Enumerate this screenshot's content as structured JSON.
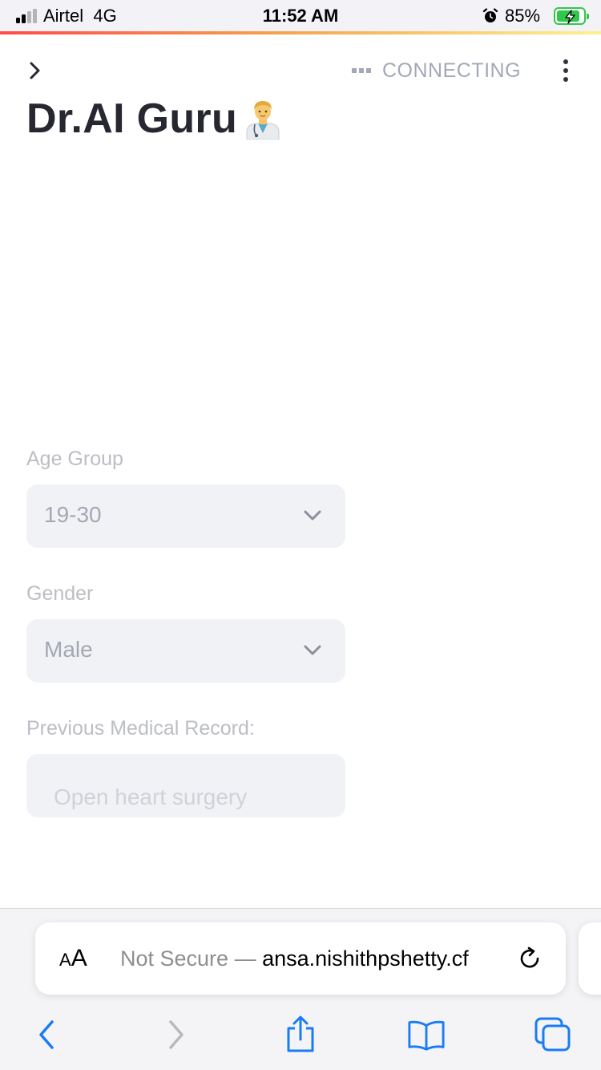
{
  "status_bar": {
    "carrier": "Airtel",
    "network": "4G",
    "time": "11:52 AM",
    "battery_percent": "85%",
    "signal_bars_active": 2,
    "signal_bars_total": 4,
    "battery_level": 0.85,
    "battery_color": "#2fc84a"
  },
  "app": {
    "status_text": "CONNECTING",
    "title": "Dr.AI Guru",
    "title_icon": "doctor-emoji-icon"
  },
  "form": {
    "age_group": {
      "label": "Age Group",
      "value": "19-30"
    },
    "gender": {
      "label": "Gender",
      "value": "Male"
    },
    "medical_record": {
      "label": "Previous Medical Record:",
      "placeholder": "Open heart surgery"
    }
  },
  "browser": {
    "text_size_button": "AA",
    "security_label": "Not Secure —",
    "url": "ansa.nishithpshetty.cf",
    "accent_color": "#1a7cf5",
    "icons": {
      "back": "chevron-left-icon",
      "forward": "chevron-right-icon",
      "share": "share-icon",
      "bookmarks": "book-icon",
      "tabs": "tabs-icon",
      "reload": "reload-icon"
    }
  }
}
